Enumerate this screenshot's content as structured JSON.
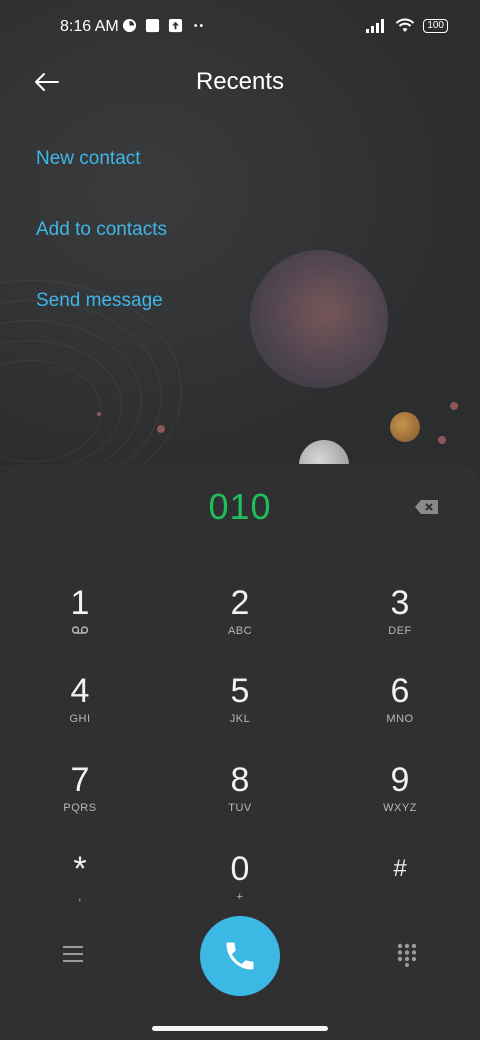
{
  "status_bar": {
    "time": "8:16 AM",
    "battery": "100"
  },
  "header": {
    "title": "Recents"
  },
  "actions": {
    "new_contact": "New contact",
    "add_to_contacts": "Add to contacts",
    "send_message": "Send message"
  },
  "dialer": {
    "number": "010",
    "keys": [
      {
        "digit": "1",
        "letters": ""
      },
      {
        "digit": "2",
        "letters": "ABC"
      },
      {
        "digit": "3",
        "letters": "DEF"
      },
      {
        "digit": "4",
        "letters": "GHI"
      },
      {
        "digit": "5",
        "letters": "JKL"
      },
      {
        "digit": "6",
        "letters": "MNO"
      },
      {
        "digit": "7",
        "letters": "PQRS"
      },
      {
        "digit": "8",
        "letters": "TUV"
      },
      {
        "digit": "9",
        "letters": "WXYZ"
      },
      {
        "digit": "*",
        "letters": ","
      },
      {
        "digit": "0",
        "letters": "+"
      },
      {
        "digit": "#",
        "letters": ""
      }
    ]
  },
  "colors": {
    "accent": "#3fb6e8",
    "number": "#1fbf5c",
    "call_button": "#3bb8e3"
  }
}
